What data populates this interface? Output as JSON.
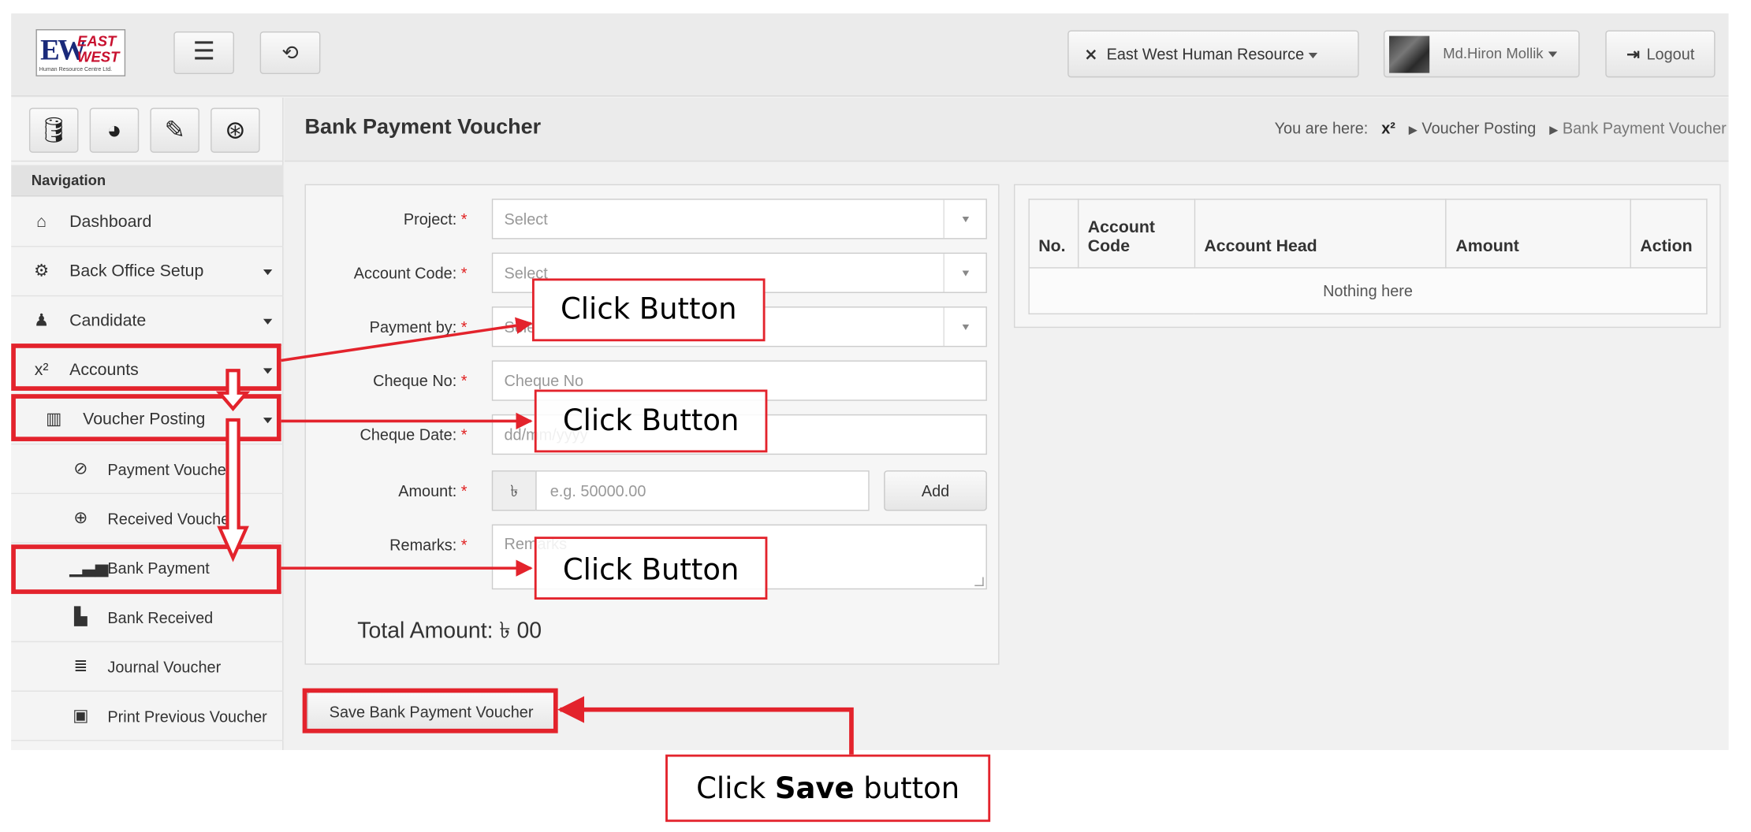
{
  "header": {
    "logo": {
      "letters": "EW",
      "line1": "EAST",
      "line2": "WEST",
      "tagline": "Human Resource Centre Ltd."
    },
    "menu_icon": "hamburger-icon",
    "history_icon": "history-icon",
    "company": "East West Human Resource",
    "user": "Md.Hiron Mollik",
    "logout": "Logout"
  },
  "sidebar": {
    "quick_icons": [
      "database-icon",
      "pie-chart-icon",
      "pencil-icon",
      "lifebuoy-icon"
    ],
    "nav_title": "Navigation",
    "items": [
      {
        "label": "Dashboard",
        "icon": "home-icon"
      },
      {
        "label": "Back Office Setup",
        "icon": "gears-icon"
      },
      {
        "label": "Candidate",
        "icon": "users-icon"
      },
      {
        "label": "Accounts",
        "icon": "superscript-icon"
      },
      {
        "label": "Voucher Posting",
        "icon": "columns-icon"
      },
      {
        "label": "Payment Voucher",
        "icon": "no-entry-icon"
      },
      {
        "label": "Received Voucher",
        "icon": "download-circle-icon"
      },
      {
        "label": "Bank Payment",
        "icon": "bar-chart-icon"
      },
      {
        "label": "Bank Received",
        "icon": "building-icon"
      },
      {
        "label": "Journal Voucher",
        "icon": "list-icon"
      },
      {
        "label": "Print Previous Voucher",
        "icon": "print-icon"
      }
    ]
  },
  "page": {
    "title": "Bank Payment Voucher",
    "breadcrumb": {
      "prefix": "You are here:",
      "home_icon": "x²",
      "items": [
        "Voucher Posting",
        "Bank Payment Voucher"
      ]
    }
  },
  "form": {
    "project_label": "Project:",
    "project_placeholder": "Select",
    "account_code_label": "Account Code:",
    "account_code_placeholder": "Select",
    "payment_by_label": "Payment by:",
    "payment_by_placeholder": "Select",
    "cheque_no_label": "Cheque No:",
    "cheque_no_placeholder": "Cheque No",
    "cheque_date_label": "Cheque Date:",
    "cheque_date_placeholder": "dd/mm/yyyy",
    "amount_label": "Amount:",
    "currency": "৳",
    "amount_placeholder": "e.g. 50000.00",
    "add_label": "Add",
    "remarks_label": "Remarks:",
    "remarks_placeholder": "Remarks",
    "required_mark": "*",
    "total_label": "Total Amount:",
    "total_value": "৳ 00",
    "save_label": "Save Bank Payment Voucher"
  },
  "table": {
    "headers": [
      "No.",
      "Account Code",
      "Account Head",
      "Amount",
      "Action"
    ],
    "empty_text": "Nothing here"
  },
  "annotations": {
    "callout_1": "Click Button",
    "callout_2": "Click Button",
    "callout_3": "Click Button",
    "save_prefix": "Click",
    "save_bold": "Save",
    "save_suffix": "button",
    "accent_color": "#e3232c"
  }
}
